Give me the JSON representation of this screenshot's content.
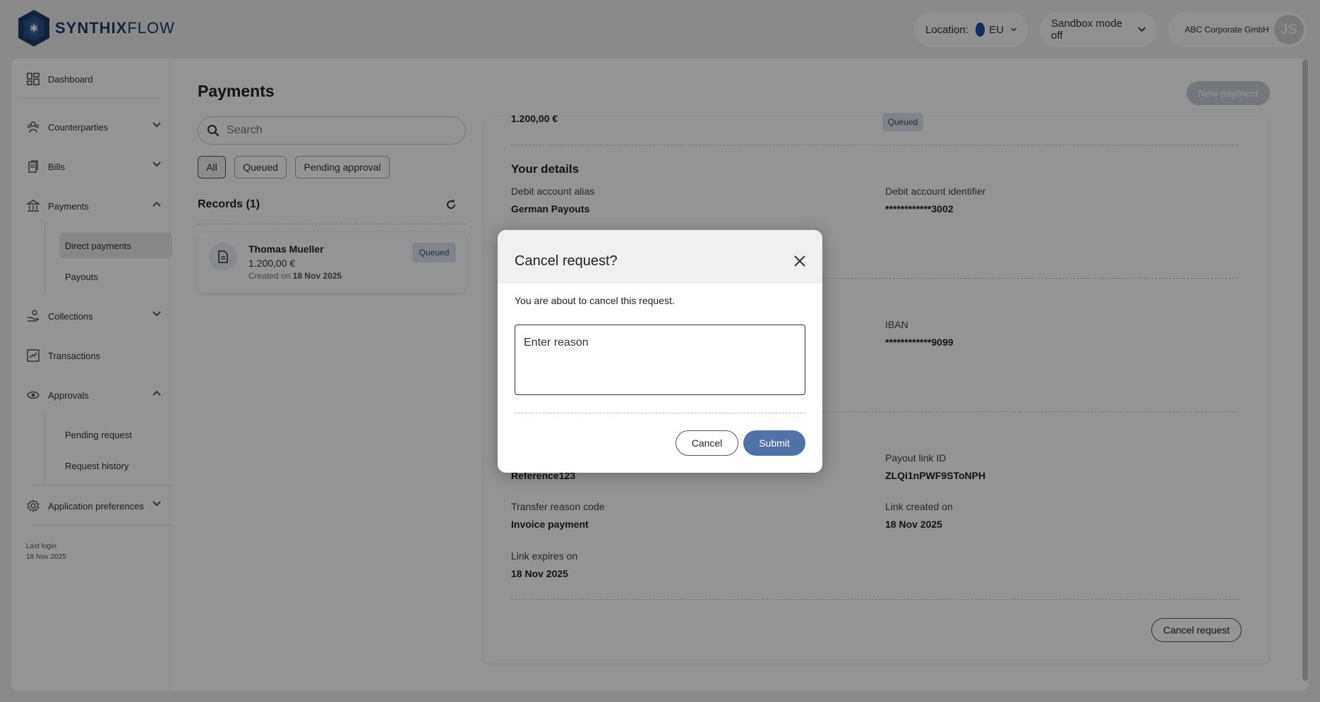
{
  "brand": {
    "bold": "SYNTHIX",
    "light": "FLOW"
  },
  "header": {
    "location_label": "Location:",
    "location_value": "EU",
    "sandbox_label": "Sandbox mode off",
    "company": "ABC Corporate GmbH",
    "avatar_initials": "JS"
  },
  "sidebar": {
    "dashboard": "Dashboard",
    "counterparties": "Counterparties",
    "bills": "Bills",
    "payments": "Payments",
    "direct_payments": "Direct payments",
    "payouts": "Payouts",
    "collections": "Collections",
    "transactions": "Transactions",
    "approvals": "Approvals",
    "pending_request": "Pending request",
    "request_history": "Request history",
    "app_prefs": "Application preferences",
    "last_login_label": "Last login",
    "last_login_date": "18 Nov 2025"
  },
  "main": {
    "title": "Payments",
    "new_payment": "New payment",
    "search_placeholder": "Search",
    "filters": [
      "All",
      "Queued",
      "Pending approval"
    ],
    "records_title": "Records (1)",
    "record": {
      "name": "Thomas Mueller",
      "amount": "1.200,00 €",
      "created_prefix": "Created on",
      "created_date": "18 Nov 2025",
      "status": "Queued"
    }
  },
  "detail": {
    "amount_top": "1.200,00 €",
    "status_top": "Queued",
    "your_details_title": "Your details",
    "debit_alias_label": "Debit account alias",
    "debit_alias_value": "German Payouts",
    "debit_id_label": "Debit account identifier",
    "debit_id_value": "************3002",
    "iban_label": "IBAN",
    "iban_value": "************9099",
    "reference_value": "Reference123",
    "payout_link_label": "Payout link ID",
    "payout_link_value": "ZLQi1nPWF9SToNPH",
    "transfer_reason_label": "Transfer reason code",
    "transfer_reason_value": "Invoice payment",
    "link_created_label": "Link created on",
    "link_created_value": "18 Nov 2025",
    "link_expires_label": "Link expires on",
    "link_expires_value": "18 Nov 2025",
    "cancel_request": "Cancel request"
  },
  "modal": {
    "title": "Cancel request?",
    "description": "You are about to cancel this request.",
    "reason_placeholder": "Enter reason",
    "cancel": "Cancel",
    "submit": "Submit"
  },
  "colors": {
    "brand": "#1f3c66",
    "accent": "#4f73a7",
    "badge_bg": "#dde3ee"
  }
}
